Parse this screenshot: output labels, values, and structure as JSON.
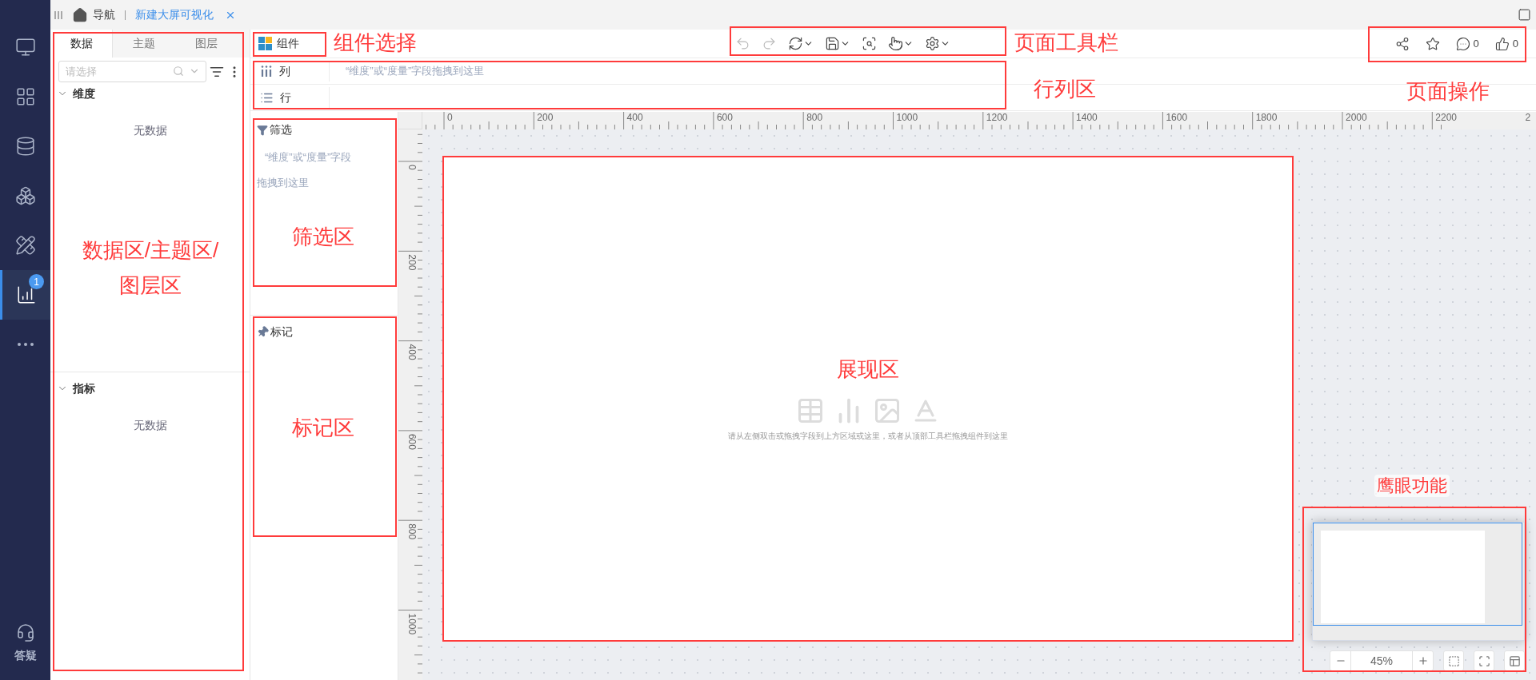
{
  "nav": {
    "items": [
      {
        "kind": "monitor",
        "selected": false
      },
      {
        "kind": "widgets",
        "selected": false
      },
      {
        "kind": "database",
        "selected": false
      },
      {
        "kind": "cubes",
        "selected": false
      },
      {
        "kind": "ruler",
        "selected": false
      },
      {
        "kind": "chart",
        "selected": true,
        "badge": "1"
      },
      {
        "kind": "more",
        "selected": false
      }
    ],
    "help": {
      "label": "答疑"
    }
  },
  "tab_bar": {
    "tabs": [
      {
        "kind": "home",
        "label": "导航",
        "selected": false
      },
      {
        "kind": "page",
        "label": "新建大屏可视化",
        "selected": true
      }
    ]
  },
  "left_panel": {
    "annotation": "数据区/主题区/图层区",
    "tabs": [
      {
        "label": "数据",
        "selected": true
      },
      {
        "label": "主题",
        "selected": false
      },
      {
        "label": "图层",
        "selected": false
      }
    ],
    "search": {
      "placeholder": "请选择"
    },
    "sections": [
      {
        "title": "维度",
        "expanded": true,
        "empty_text": "无数据"
      },
      {
        "title": "指标",
        "expanded": true,
        "empty_text": "无数据"
      }
    ]
  },
  "component_button": {
    "label": "组件",
    "annotation": "组件选择"
  },
  "page_toolbar": {
    "annotation": "页面工具栏",
    "tools": [
      {
        "kind": "undo",
        "disabled": true,
        "dropdown": false
      },
      {
        "kind": "redo",
        "disabled": true,
        "dropdown": false
      },
      {
        "kind": "refresh",
        "disabled": false,
        "dropdown": true
      },
      {
        "kind": "save",
        "disabled": false,
        "dropdown": true
      },
      {
        "kind": "preview",
        "disabled": false,
        "dropdown": false
      },
      {
        "kind": "touch",
        "disabled": false,
        "dropdown": true
      },
      {
        "kind": "settings",
        "disabled": false,
        "dropdown": true
      }
    ]
  },
  "page_actions": {
    "annotation": "页面操作",
    "items": [
      {
        "kind": "share"
      },
      {
        "kind": "star"
      },
      {
        "kind": "comment",
        "count": "0"
      },
      {
        "kind": "like",
        "count": "0"
      }
    ]
  },
  "shelves": {
    "annotation": "行列区",
    "rows": [
      {
        "kind": "columns",
        "label": "列",
        "placeholder": "“维度”或“度量”字段拖拽到这里"
      },
      {
        "kind": "rows",
        "label": "行"
      }
    ]
  },
  "filter_panel": {
    "title": "筛选",
    "hint": "“维度”或“度量”字段拖拽到这里",
    "annotation": "筛选区"
  },
  "marks_panel": {
    "title": "标记",
    "annotation": "标记区"
  },
  "canvas": {
    "annotation": "展现区",
    "hint": "请从左侧双击或拖拽字段到上方区域或这里，或者从顶部工具栏拖拽组件到这里",
    "x_ruler": [
      "0",
      "200",
      "400",
      "600",
      "800",
      "1000",
      "1200",
      "1400",
      "1600",
      "1800",
      "2000",
      "2200",
      "2"
    ],
    "y_ruler": [
      "0",
      "200",
      "400",
      "600",
      "800",
      "1000"
    ]
  },
  "minimap": {
    "annotation": "鹰眼功能",
    "zoom": "45%"
  }
}
